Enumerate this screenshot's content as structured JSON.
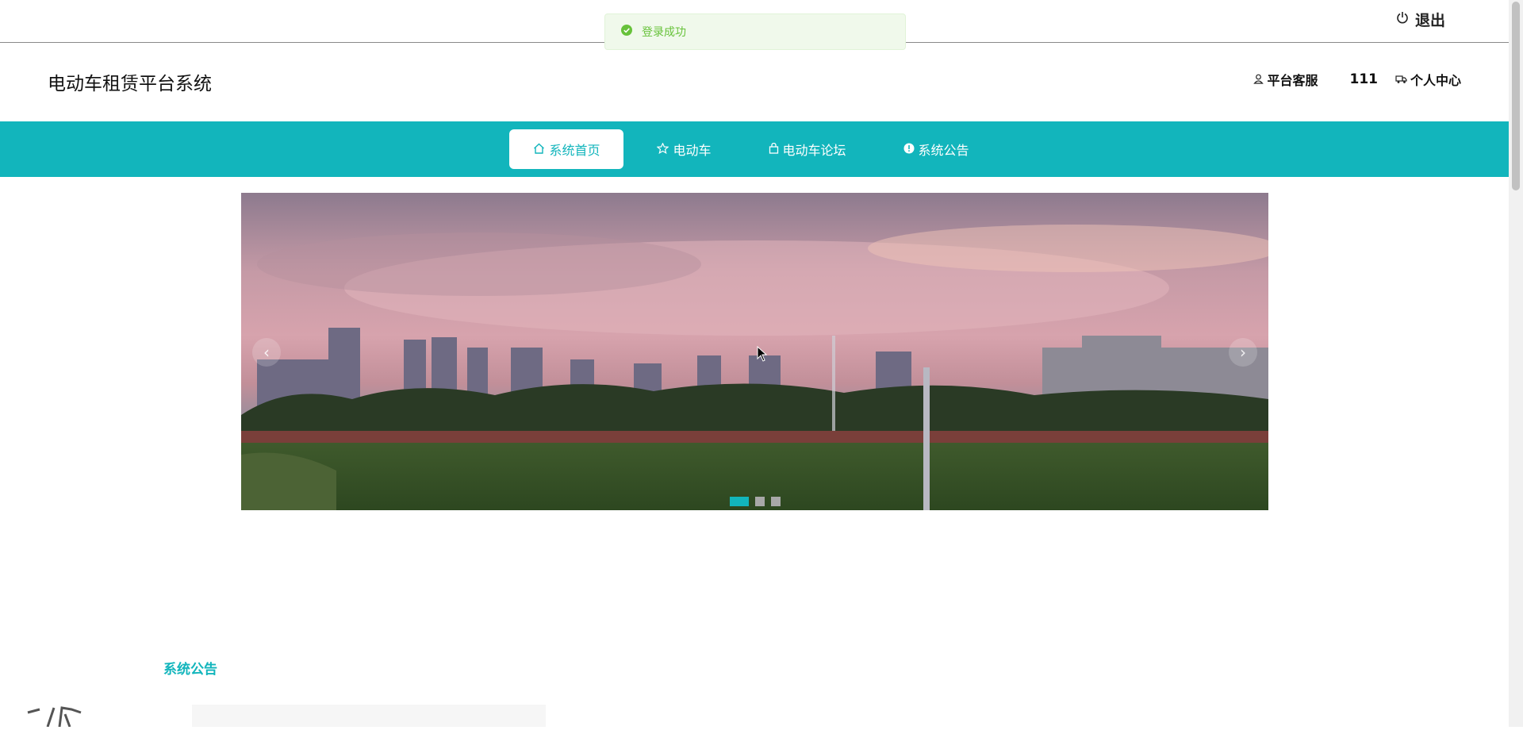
{
  "toast": {
    "message": "登录成功"
  },
  "topbar": {
    "logout_label": "退出"
  },
  "header": {
    "site_title": "电动车租赁平台系统",
    "service_label": "平台客服",
    "username": "111",
    "profile_label": "个人中心"
  },
  "nav": {
    "items": [
      {
        "label": "系统首页",
        "icon": "home-icon",
        "active": true
      },
      {
        "label": "电动车",
        "icon": "star-icon",
        "active": false
      },
      {
        "label": "电动车论坛",
        "icon": "bag-icon",
        "active": false
      },
      {
        "label": "系统公告",
        "icon": "info-icon",
        "active": false
      }
    ]
  },
  "banner": {
    "slide_count": 3,
    "active_slide": 1
  },
  "notice": {
    "section_title": "系统公告"
  },
  "colors": {
    "accent": "#12b5bc",
    "success": "#67c23a"
  }
}
